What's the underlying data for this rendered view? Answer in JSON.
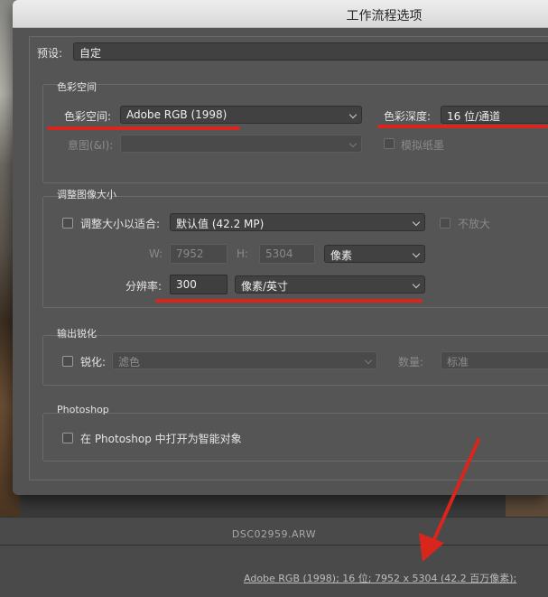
{
  "dialog": {
    "title": "工作流程选项",
    "preset_label": "预设:",
    "preset_value": "自定"
  },
  "color_space": {
    "group_title": "色彩空间",
    "space_label": "色彩空间:",
    "space_value": "Adobe RGB (1998)",
    "depth_label": "色彩深度:",
    "depth_value": "16 位/通道",
    "intent_label": "意图(&I):",
    "intent_value": "",
    "simulate_paper_label": "模拟纸墨"
  },
  "image_size": {
    "group_title": "调整图像大小",
    "resize_label": "调整大小以适合:",
    "resize_value": "默认值 (42.2 MP)",
    "dont_enlarge_label": "不放大",
    "w_label": "W:",
    "w_value": "7952",
    "h_label": "H:",
    "h_value": "5304",
    "unit_value": "像素",
    "resolution_label": "分辨率:",
    "resolution_value": "300",
    "resolution_unit": "像素/英寸"
  },
  "sharpen": {
    "group_title": "输出锐化",
    "sharpen_label": "锐化:",
    "sharpen_value": "滤色",
    "amount_label": "数量:",
    "amount_value": "标准"
  },
  "photoshop": {
    "group_title": "Photoshop",
    "smart_object_label": "在 Photoshop 中打开为智能对象"
  },
  "footer": {
    "filename": "DSC02959.ARW",
    "file_info": "Adobe RGB (1998); 16 位; 7952 x 5304 (42.2 百万像素);"
  },
  "colors": {
    "annotation_red": "#d9261c",
    "dialog_bg": "#535353",
    "titlebar_bg": "#e3e3e3"
  }
}
